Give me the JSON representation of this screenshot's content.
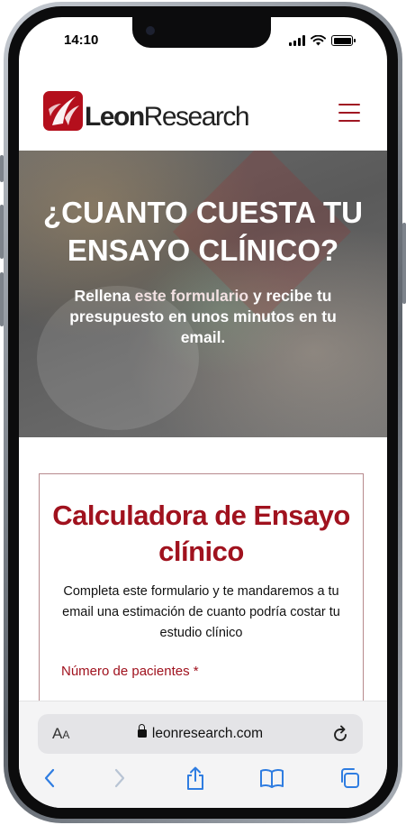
{
  "status_bar": {
    "time": "14:10"
  },
  "header": {
    "logo_text_bold": "Leon",
    "logo_text_regular": "Research",
    "brand_color": "#b40f1c"
  },
  "hero": {
    "title": "¿CUANTO CUESTA TU ENSAYO CLÍNICO?",
    "subtitle_part1": "Rellena ",
    "subtitle_highlight": "este formulario",
    "subtitle_part2": " y recibe tu presupuesto en unos minutos en tu email."
  },
  "card": {
    "title": "Calculadora de Ensayo clínico",
    "description": "Completa este formulario y te mandaremos a tu email una estimación de cuanto podría costar tu estudio clínico",
    "field_label": "Número de pacientes *"
  },
  "browser": {
    "aa_label_big": "A",
    "aa_label_small": "A",
    "url": "leonresearch.com",
    "icons": [
      "lock-icon",
      "reload-icon",
      "back-icon",
      "forward-icon",
      "share-icon",
      "bookmarks-icon",
      "tabs-icon"
    ]
  },
  "colors": {
    "accent": "#a0121e",
    "ios_blue": "#2f7de1"
  }
}
